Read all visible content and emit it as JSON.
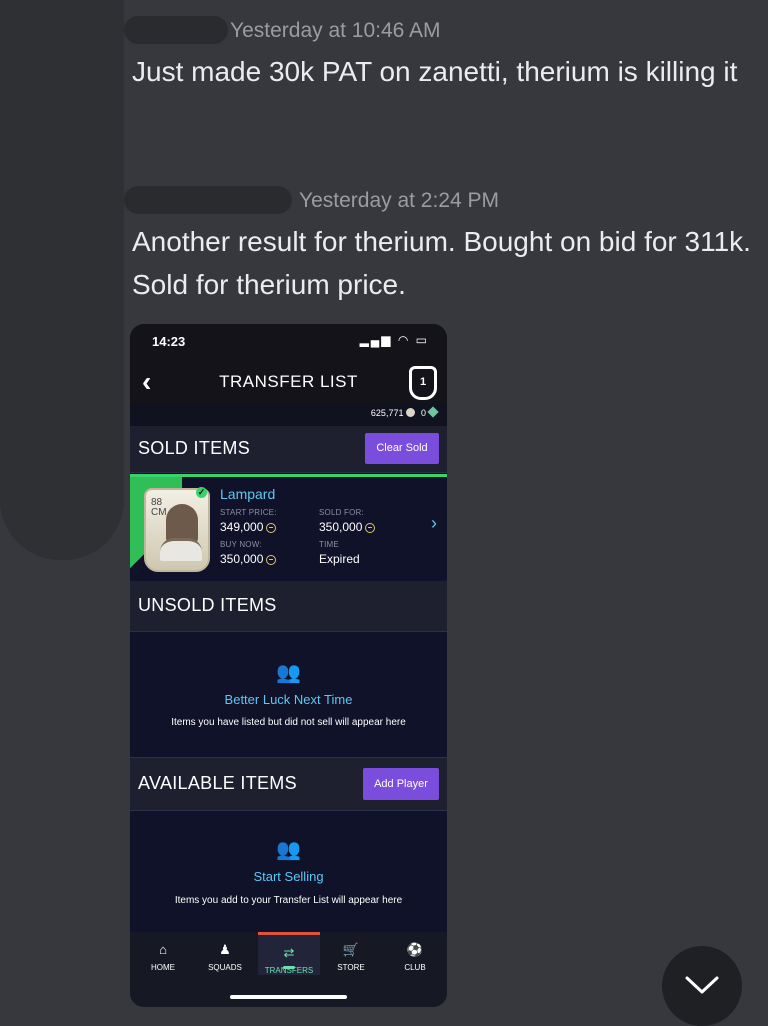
{
  "messages": [
    {
      "timestamp": "Yesterday at 10:46 AM",
      "text": "Just made 30k PAT on zanetti, therium is killing it"
    },
    {
      "timestamp": "Yesterday at 2:24 PM",
      "text": "Another result for therium. Bought on bid for 311k. Sold for therium price."
    }
  ],
  "phone": {
    "status_time": "14:23",
    "title": "TRANSFER LIST",
    "coins": "625,771",
    "points": "0",
    "sold": {
      "title": "SOLD ITEMS",
      "button": "Clear Sold",
      "player": {
        "name": "Lampard",
        "rating": "88",
        "position": "CM",
        "start_price_label": "START PRICE:",
        "start_price": "349,000",
        "buy_now_label": "BUY NOW:",
        "buy_now": "350,000",
        "sold_for_label": "SOLD FOR:",
        "sold_for": "350,000",
        "time_label": "TIME",
        "time": "Expired"
      }
    },
    "unsold": {
      "title": "UNSOLD ITEMS",
      "empty_title": "Better Luck Next Time",
      "empty_text": "Items you have listed but did not sell will appear here"
    },
    "available": {
      "title": "AVAILABLE ITEMS",
      "button": "Add Player",
      "empty_title": "Start Selling",
      "empty_text": "Items you add to your Transfer List will appear here"
    },
    "tabs": [
      "HOME",
      "SQUADS",
      "TRANSFERS",
      "STORE",
      "CLUB"
    ],
    "active_tab": "TRANSFERS"
  },
  "icons": {
    "back": "chevron-left-icon",
    "club": "club-badge-icon",
    "scroll": "chevron-down-icon"
  },
  "colors": {
    "background": "#36383d",
    "accent_purple": "#7b4ddc",
    "sold_green": "#2fbf56",
    "link_blue": "#5fc7f2",
    "active_tab": "#6fe0b0"
  }
}
